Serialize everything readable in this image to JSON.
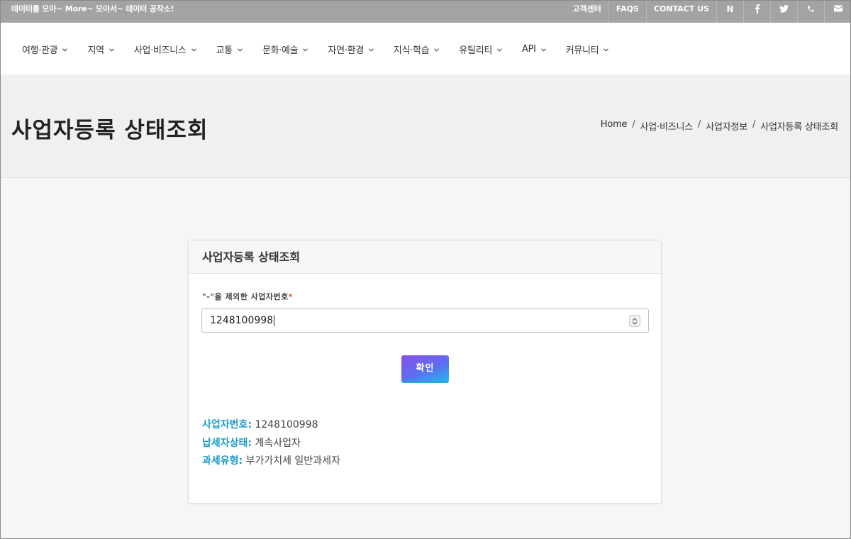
{
  "topbar": {
    "tagline": "데이터를 모아~ More~ 모아서~ 데이터 공작소!",
    "links": [
      "고객센터",
      "FAQS",
      "CONTACT US"
    ],
    "naver_label": "N",
    "icons": [
      "facebook-icon",
      "twitter-icon",
      "phone-icon",
      "mail-icon"
    ]
  },
  "nav": {
    "items": [
      "여행·관광",
      "지역",
      "사업·비즈니스",
      "교통",
      "문화·예술",
      "자연·환경",
      "지식·학습",
      "유틸리티",
      "API",
      "커뮤니티"
    ]
  },
  "page": {
    "title": "사업자등록 상태조회",
    "breadcrumb": [
      "Home",
      "사업·비즈니스",
      "사업자정보",
      "사업자등록 상태조회"
    ]
  },
  "form": {
    "header": "사업자등록 상태조회",
    "label": "\"-\"을 제외한 사업자번호",
    "required_mark": "*",
    "value": "1248100998",
    "button_label": "확인"
  },
  "result": {
    "items": [
      {
        "key": "사업자번호:",
        "value": "1248100998"
      },
      {
        "key": "납세자상태:",
        "value": "계속사업자"
      },
      {
        "key": "과세유형:",
        "value": "부가가치세 일반과세자"
      }
    ]
  },
  "colors": {
    "topbar": "#a3a3a3",
    "result_key": "#1d9bc9",
    "button_gradient": [
      "#8b4fe6",
      "#5b6ff0",
      "#23b7f0"
    ]
  }
}
